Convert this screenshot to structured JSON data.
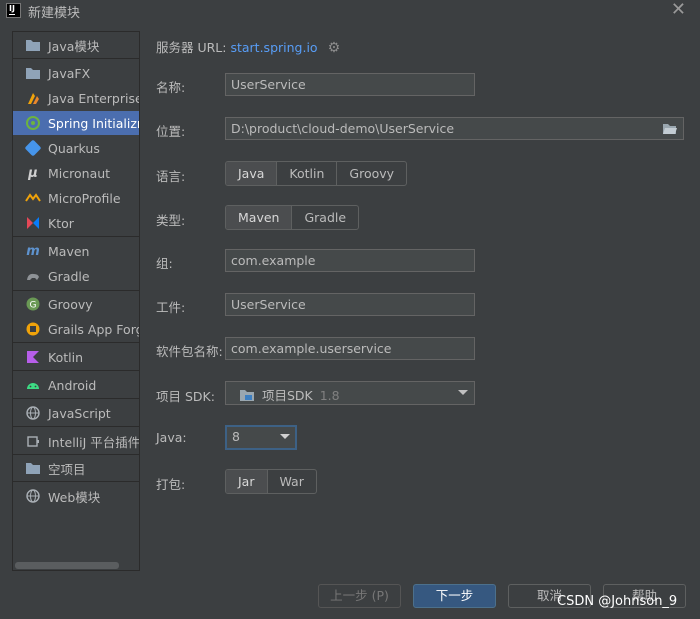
{
  "window": {
    "icon": "IJ",
    "title": "新建模块",
    "close": "✕"
  },
  "sidebar": {
    "items": [
      {
        "label": "Java模块",
        "icon": "folder-icon"
      },
      {
        "label": "JavaFX",
        "icon": "folder-icon"
      },
      {
        "label": "Java Enterprise",
        "icon": "enterprise-icon"
      },
      {
        "label": "Spring Initializr",
        "icon": "spring-icon"
      },
      {
        "label": "Quarkus",
        "icon": "quarkus-icon"
      },
      {
        "label": "Micronaut",
        "icon": "micronaut-icon"
      },
      {
        "label": "MicroProfile",
        "icon": "microprofile-icon"
      },
      {
        "label": "Ktor",
        "icon": "ktor-icon"
      },
      {
        "label": "Maven",
        "icon": "maven-icon"
      },
      {
        "label": "Gradle",
        "icon": "gradle-icon"
      },
      {
        "label": "Groovy",
        "icon": "groovy-icon"
      },
      {
        "label": "Grails App Forge",
        "icon": "grails-icon"
      },
      {
        "label": "Kotlin",
        "icon": "kotlin-icon"
      },
      {
        "label": "Android",
        "icon": "android-icon"
      },
      {
        "label": "JavaScript",
        "icon": "globe-icon"
      },
      {
        "label": "IntelliJ 平台插件",
        "icon": "plugin-icon"
      },
      {
        "label": "空项目",
        "icon": "folder-icon"
      },
      {
        "label": "Web模块",
        "icon": "globe-icon"
      }
    ],
    "selected": "Spring Initializr"
  },
  "form": {
    "server_label": "服务器 URL:",
    "server_url": "start.spring.io",
    "name_label": "名称:",
    "name_value": "UserService",
    "location_label": "位置:",
    "location_value": "D:\\product\\cloud-demo\\UserService",
    "language_label": "语言:",
    "languages": [
      "Java",
      "Kotlin",
      "Groovy"
    ],
    "language_selected": "Java",
    "type_label": "类型:",
    "types": [
      "Maven",
      "Gradle"
    ],
    "type_selected": "Maven",
    "group_label": "组:",
    "group_value": "com.example",
    "artifact_label": "工件:",
    "artifact_value": "UserService",
    "package_label": "软件包名称:",
    "package_value": "com.example.userservice",
    "sdk_label": "项目 SDK:",
    "sdk_value": "项目SDK",
    "sdk_version": "1.8",
    "java_label": "Java:",
    "java_value": "8",
    "packaging_label": "打包:",
    "packagings": [
      "Jar",
      "War"
    ],
    "packaging_selected": "Jar"
  },
  "buttons": {
    "prev": "上一步 (P)",
    "next": "下一步",
    "cancel": "取消",
    "help": "帮助"
  },
  "watermark": "CSDN @Johnson_9",
  "colors": {
    "accent": "#4b6eaf",
    "link": "#589df6",
    "primary_button": "#365880",
    "background": "#3c3f41"
  }
}
